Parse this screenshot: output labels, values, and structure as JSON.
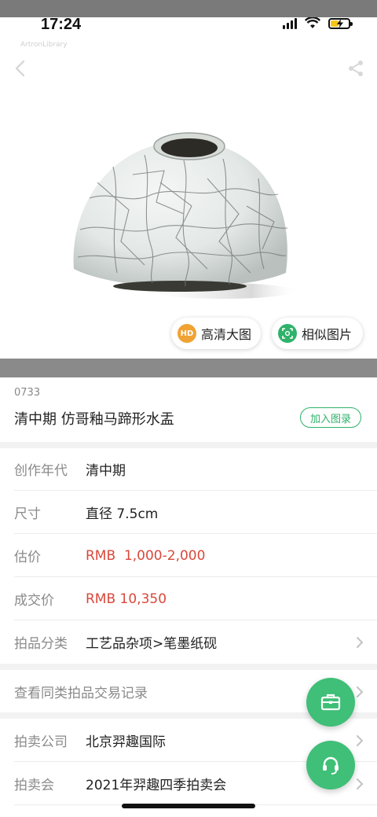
{
  "status": {
    "time": "17:24"
  },
  "hero": {
    "watermark": "ArtronLibrary",
    "hd_label": "高清大图",
    "hd_badge": "HD",
    "similar_label": "相似图片"
  },
  "lot": {
    "number": "0733",
    "title": "清中期 仿哥釉马蹄形水盂",
    "catalog_button": "加入图录"
  },
  "details": [
    {
      "label": "创作年代",
      "value": "清中期"
    },
    {
      "label": "尺寸",
      "value": "直径 7.5cm"
    },
    {
      "label": "估价",
      "value": "RMB  1,000-2,000"
    },
    {
      "label": "成交价",
      "value": "RMB 10,350"
    },
    {
      "label": "拍品分类",
      "value": "工艺品杂项>笔墨纸砚"
    }
  ],
  "records_link": "查看同类拍品交易记录",
  "auction": [
    {
      "label": "拍卖公司",
      "value": "北京羿趣国际"
    },
    {
      "label": "拍卖会",
      "value": "2021年羿趣四季拍卖会"
    }
  ],
  "colors": {
    "accent": "#2fb26a",
    "price_red": "#d9483b",
    "hd_orange": "#f0a233"
  }
}
